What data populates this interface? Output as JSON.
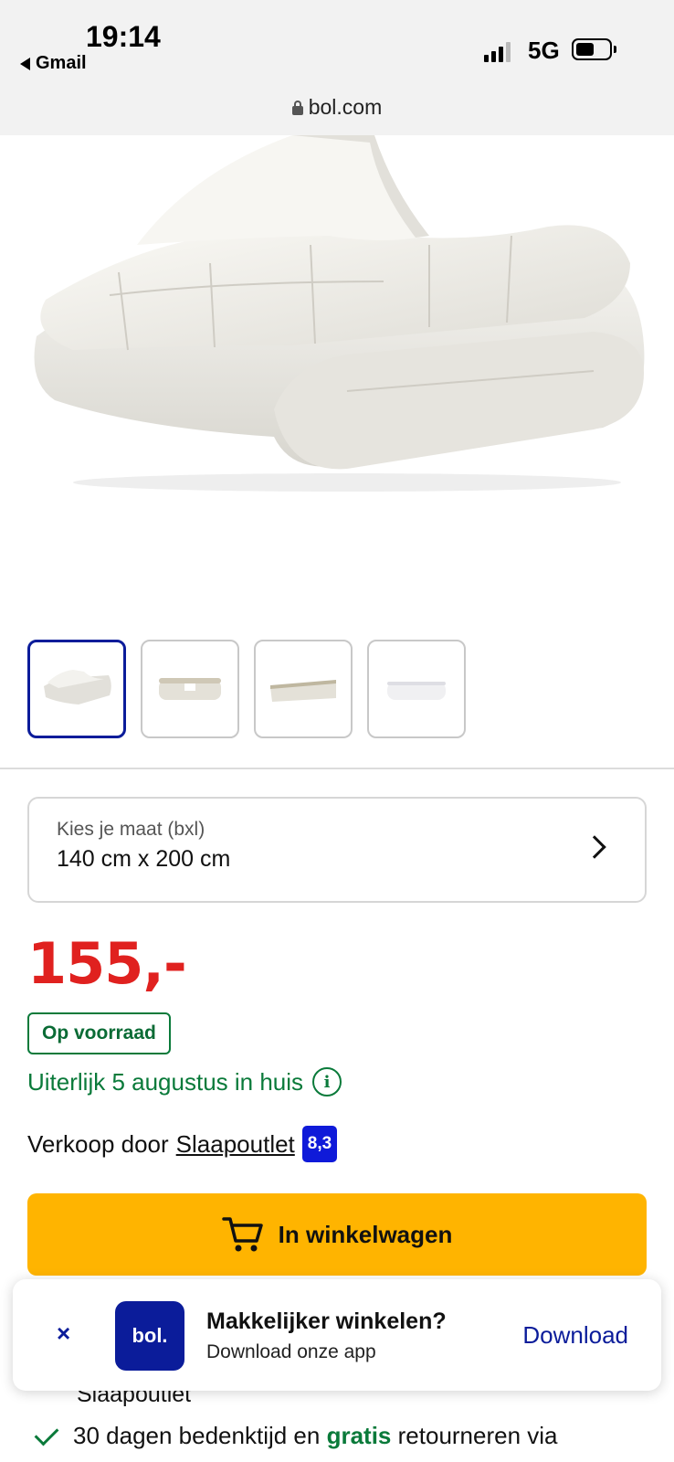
{
  "status_bar": {
    "time": "19:14",
    "back_app": "Gmail",
    "network": "5G"
  },
  "browser": {
    "url": "bol.com"
  },
  "product": {
    "thumbnails": [
      {
        "name": "thumb-1",
        "active": true
      },
      {
        "name": "thumb-2",
        "active": false
      },
      {
        "name": "thumb-3",
        "active": false
      },
      {
        "name": "thumb-4",
        "active": false
      }
    ],
    "size_label": "Kies je maat (bxl)",
    "size_value": "140 cm x 200 cm",
    "price": "155,-",
    "stock": "Op voorraad",
    "delivery": "Uiterlijk 5 augustus in huis",
    "seller_prefix": "Verkoop door",
    "seller_name": "Slaapoutlet",
    "seller_rating": "8,3",
    "cart_label": "In winkelwagen"
  },
  "usps": {
    "cut_text": "Slaapoutlet",
    "return_pre": "30 dagen bedenktijd en",
    "return_bold": "gratis",
    "return_post": "retourneren via"
  },
  "app_banner": {
    "close": "×",
    "logo": "bol.",
    "title": "Makkelijker winkelen?",
    "subtitle": "Download onze app",
    "cta": "Download"
  },
  "colors": {
    "price_red": "#e0211f",
    "stock_green": "#0a7a3a",
    "brand_blue": "#0b1c9a",
    "cart_yellow": "#ffb400"
  }
}
